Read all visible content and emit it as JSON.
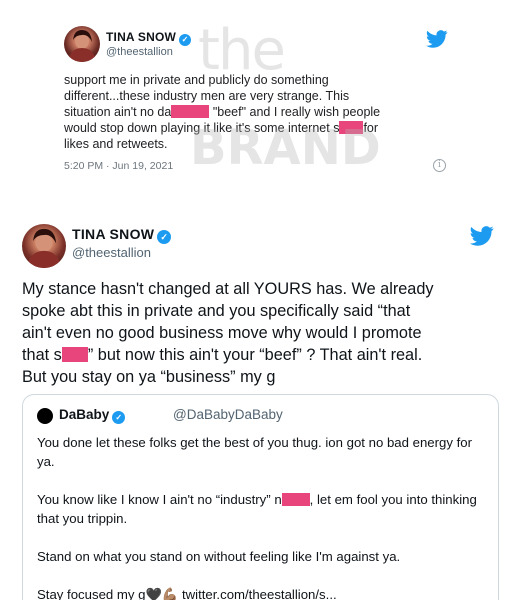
{
  "tweet1": {
    "name": "TINA SNOW",
    "handle": "@theestallion",
    "text_lines": [
      "support me in private and publicly do something",
      "different...these industry men are very strange. This",
      "situation ain't no da",
      "\"beef\" and I really wish people",
      "would stop down playing it like it's some internet s",
      "for",
      "likes and retweets."
    ],
    "timestamp": "5:20 PM · Jun 19, 2021",
    "info_glyph": "i",
    "icons": {
      "bird": "twitter-bird-icon",
      "verified": "verified-badge-icon",
      "info": "info-icon"
    },
    "colors": {
      "brand": "#1d9bf0",
      "redaction": "#e8457c"
    }
  },
  "watermark": {
    "line1": "the",
    "line2": "BRAND"
  },
  "tweet2": {
    "name": "TINA SNOW",
    "handle": "@theestallion",
    "text": {
      "line1": "My stance hasn't changed at all YOURS has. We already",
      "line2": "spoke abt this in private and you specifically said “that",
      "line3": "ain't even no good business move why would I promote",
      "line4a": "that s",
      "line4b": "” but now this ain't your “beef” ? That ain't real.",
      "line5": "But you stay on ya “business” my g"
    }
  },
  "quote": {
    "name": "DaBaby",
    "handle": "@DaBabyDaBaby",
    "p1": "You done let these folks get the best of you thug. ion got no bad energy for ya.",
    "p2a": "You know like I know I ain't no “industry” n",
    "p2b": ", let em fool you into thinking that you trippin.",
    "p3": "Stand on what you stand on without feeling like I'm against ya.",
    "p4a": "Stay focused my g",
    "p4_emoji": "🖤💪🏽",
    "p4b": " twitter.com/theestallion/s..."
  }
}
